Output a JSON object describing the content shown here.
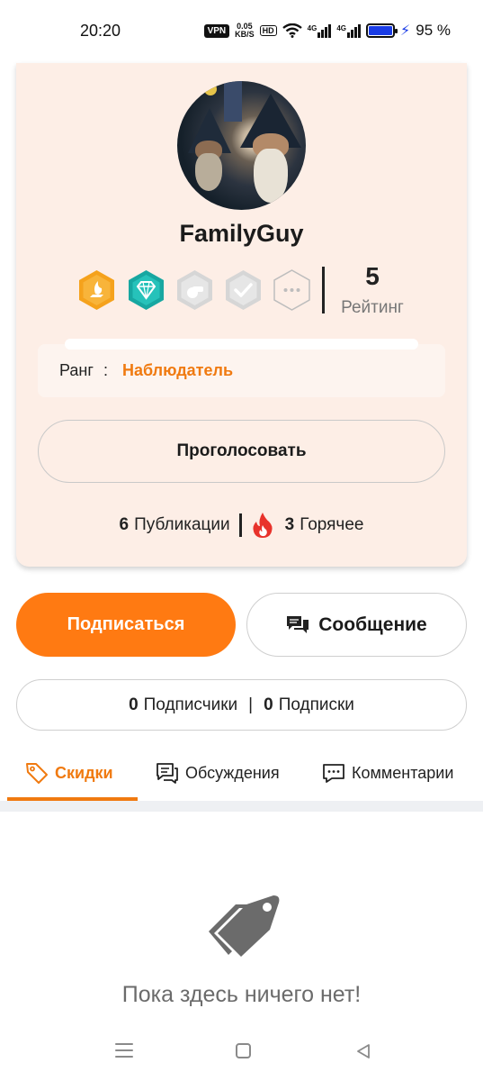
{
  "status_bar": {
    "time": "20:20",
    "vpn": "VPN",
    "speed_top": "0.05",
    "speed_bottom": "KB/S",
    "hd": "HD",
    "net1": "4G",
    "net2": "4G",
    "battery": "95 %"
  },
  "profile": {
    "username": "FamilyGuy",
    "badges": [
      {
        "name": "creator-badge",
        "color": "#f5a21c",
        "active": true
      },
      {
        "name": "diamond-badge",
        "color": "#1fb8b0",
        "active": true
      },
      {
        "name": "whistle-badge",
        "color": "#d9d9d9",
        "active": false
      },
      {
        "name": "check-badge",
        "color": "#d9d9d9",
        "active": false
      },
      {
        "name": "more-badge",
        "color": "#bbbbbb",
        "active": false
      }
    ],
    "rating_value": "5",
    "rating_label": "Рейтинг",
    "rank_label": "Ранг",
    "rank_colon": ":",
    "rank_value": "Наблюдатель",
    "vote_button": "Проголосовать",
    "publications_count": "6",
    "publications_label": "Публикации",
    "hot_count": "3",
    "hot_label": "Горячее"
  },
  "actions": {
    "subscribe": "Подписаться",
    "message": "Сообщение"
  },
  "follow": {
    "followers_count": "0",
    "followers_label": "Подписчики",
    "separator": "|",
    "following_count": "0",
    "following_label": "Подписки"
  },
  "tabs": [
    {
      "label": "Скидки",
      "active": true
    },
    {
      "label": "Обсуждения",
      "active": false
    },
    {
      "label": "Комментарии",
      "active": false
    }
  ],
  "empty_state": {
    "text": "Пока здесь ничего нет!"
  },
  "colors": {
    "accent": "#ff7a12",
    "card_bg": "#fdeee6"
  }
}
